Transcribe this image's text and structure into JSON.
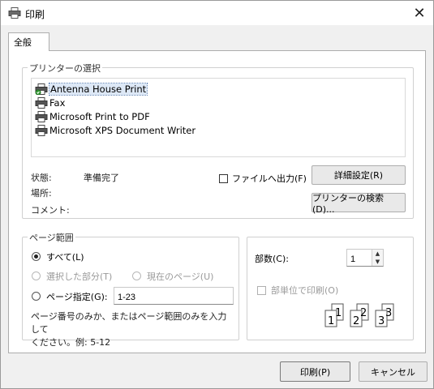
{
  "window": {
    "title": "印刷",
    "close_icon": "close-icon"
  },
  "tabs": [
    {
      "label": "全般",
      "active": true
    }
  ],
  "printer_section": {
    "legend": "プリンターの選択",
    "printers": [
      {
        "name": "Antenna House Print",
        "selected": true
      },
      {
        "name": "Fax",
        "selected": false
      },
      {
        "name": "Microsoft Print to PDF",
        "selected": false
      },
      {
        "name": "Microsoft XPS Document Writer",
        "selected": false
      }
    ],
    "status_label": "状態:",
    "status_value": "準備完了",
    "location_label": "場所:",
    "location_value": "",
    "comment_label": "コメント:",
    "comment_value": "",
    "print_to_file_label": "ファイルへ出力(F)",
    "print_to_file_checked": false,
    "preferences_button": "詳細設定(R)",
    "find_printer_button": "プリンターの検索(D)..."
  },
  "page_range": {
    "legend": "ページ範囲",
    "all_label": "すべて(L)",
    "selection_label": "選択した部分(T)",
    "current_page_label": "現在のページ(U)",
    "pages_label": "ページ指定(G):",
    "pages_value": "1-23",
    "selected": "all",
    "hint": "ページ番号のみか、またはページ範囲のみを入力して\nください。例: 5-12"
  },
  "copies": {
    "label": "部数(C):",
    "value": "1",
    "collate_label": "部単位で印刷(O)",
    "collate_checked": false,
    "collate_icon_numbers": [
      "1",
      "1",
      "2",
      "2",
      "3",
      "3"
    ]
  },
  "footer": {
    "print_button": "印刷(P)",
    "cancel_button": "キャンセル"
  }
}
